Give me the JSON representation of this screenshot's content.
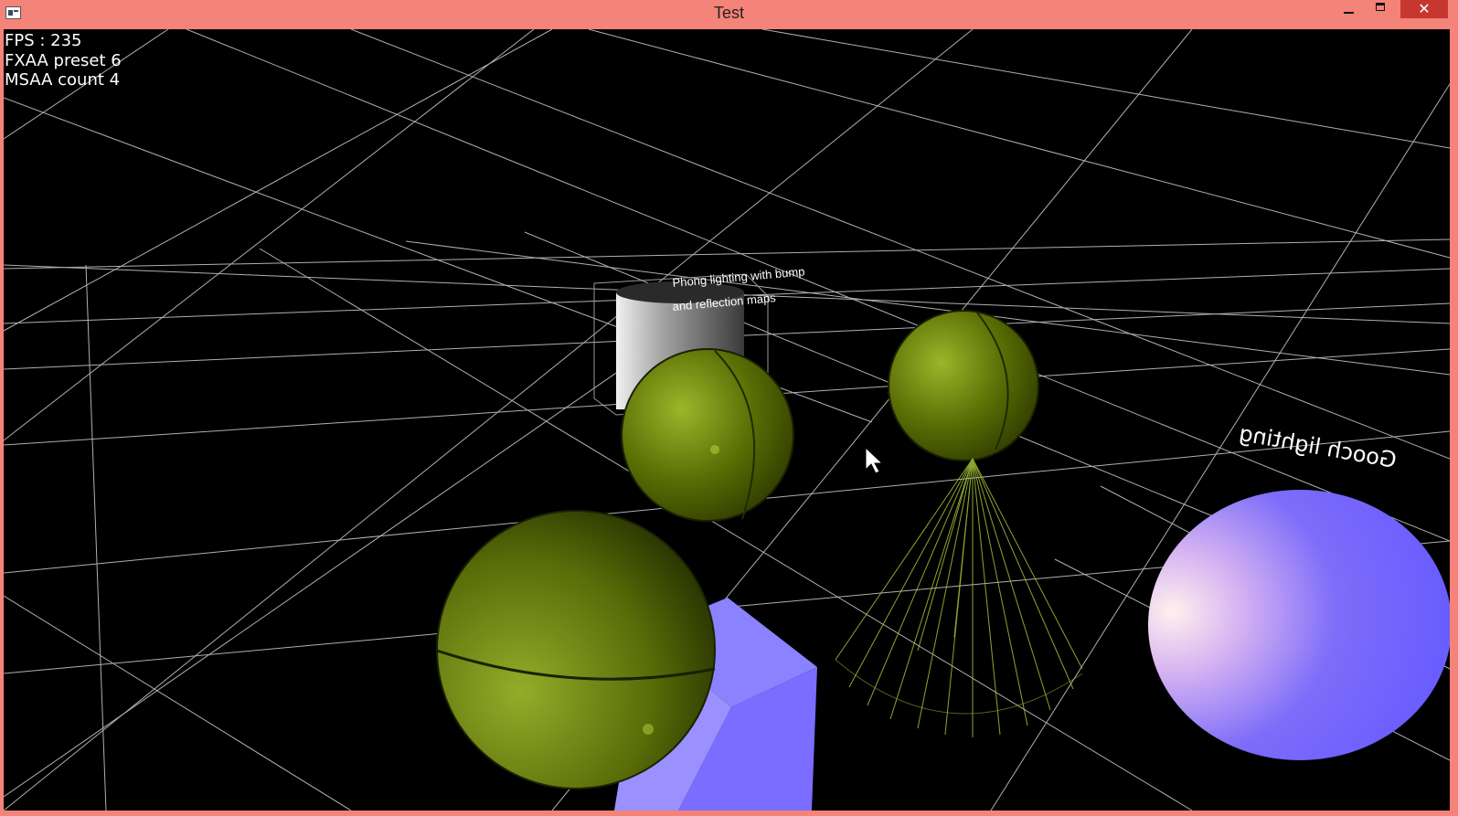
{
  "window": {
    "title": "Test",
    "close_glyph": "✕",
    "icons": [
      "app-icon",
      "minimize-icon",
      "maximize-icon",
      "close-icon"
    ]
  },
  "hud": {
    "fps": "FPS : 235",
    "fxaa": "FXAA preset 6",
    "msaa": "MSAA count 4"
  },
  "scene": {
    "labels": {
      "phong_line1": "Phong lighting with bump",
      "phong_line2": "and reflection maps",
      "gooch": "Gooch lighting"
    }
  },
  "colors": {
    "titlebar": "#f48379",
    "close_button": "#c7372f",
    "viewport_bg": "#000000",
    "grid": "#cfcfcf",
    "glass_sphere": "#7f9a0a",
    "cone_wire": "#a5c23a",
    "cube": "#8a7dff",
    "gooch_sphere": "#7468ff"
  }
}
